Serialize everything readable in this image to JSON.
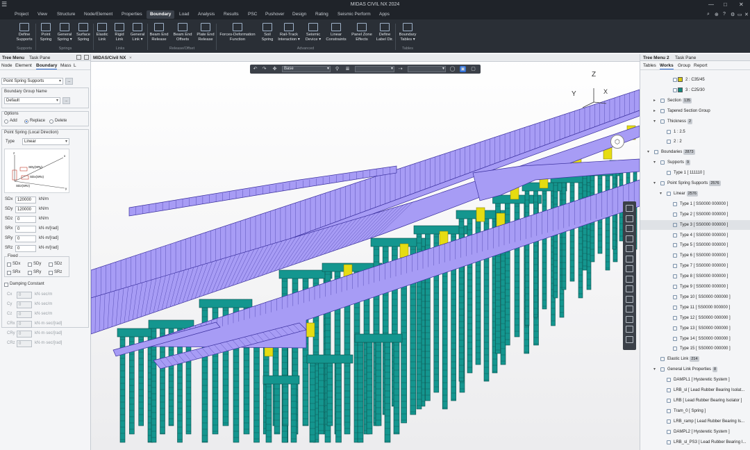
{
  "app": {
    "title": "MIDAS CIVIL NX 2024",
    "window_controls": [
      "—",
      "□",
      "✕"
    ]
  },
  "menu": {
    "items": [
      "Project",
      "View",
      "Structure",
      "Node/Element",
      "Properties",
      "Boundary",
      "Load",
      "Analysis",
      "Results",
      "PSC",
      "Pushover",
      "Design",
      "Rating",
      "Seismic Perform",
      "Apps"
    ],
    "active": "Boundary",
    "right_icons": [
      "search-icon",
      "zoom-icon",
      "help-icon",
      "settings-icon",
      "restore-icon",
      "close-icon"
    ],
    "right_glyphs": [
      "⌕",
      "⊕",
      "?",
      "⚙",
      "▭",
      "✕"
    ]
  },
  "ribbon": {
    "buttons": [
      {
        "label": "Define\nSupports",
        "icon": "support-icon"
      },
      {
        "label": "Point\nSpring",
        "icon": "point-spring-icon"
      },
      {
        "label": "General\nSpring ▾",
        "icon": "general-spring-icon"
      },
      {
        "label": "Surface\nSpring",
        "icon": "surface-spring-icon"
      },
      {
        "label": "Elastic\nLink",
        "icon": "elastic-link-icon"
      },
      {
        "label": "Rigid\nLink",
        "icon": "rigid-link-icon"
      },
      {
        "label": "General\nLink ▾",
        "icon": "general-link-icon"
      },
      {
        "label": "Beam End\nRelease",
        "icon": "beam-end-release-icon"
      },
      {
        "label": "Beam End\nOffsets",
        "icon": "beam-end-offsets-icon"
      },
      {
        "label": "Plate End\nRelease",
        "icon": "plate-end-release-icon"
      },
      {
        "label": "Forces-Deformation\nFunction",
        "icon": "force-function-icon"
      },
      {
        "label": "Soil\nSpring",
        "icon": "soil-spring-icon"
      },
      {
        "label": "Rail-Track\nInteraction ▾",
        "icon": "rail-track-icon"
      },
      {
        "label": "Seismic\nDevice ▾",
        "icon": "seismic-device-icon"
      },
      {
        "label": "Linear\nConstraints",
        "icon": "linear-constraints-icon"
      },
      {
        "label": "Panel Zone\nEffects",
        "icon": "panel-zone-icon"
      },
      {
        "label": "Define\nLabel Dir.",
        "icon": "label-dir-icon"
      },
      {
        "label": "Boundary\nTables ▾",
        "icon": "boundary-tables-icon"
      }
    ],
    "groups": [
      "Supports",
      "Springs",
      "Links",
      "Release/Offset",
      "Advanced",
      "Tables"
    ]
  },
  "left_panel": {
    "header_tabs": [
      "Tree Menu",
      "Task Pane"
    ],
    "tabs": [
      "Node",
      "Element",
      "Boundary",
      "Mass",
      "L"
    ],
    "active_tab": "Boundary",
    "function_select": "Point Spring Supports",
    "group_label": "Boundary Group Name",
    "group_value": "Default",
    "options_label": "Options",
    "options": [
      "Add",
      "Replace",
      "Delete"
    ],
    "option_selected": "Replace",
    "spring_label": "Point Spring (Local Direction)",
    "type_label": "Type",
    "type_value": "Linear",
    "diagram_labels": [
      "SDz(SRz)",
      "SDx(SRx)",
      "SDy(SRy)",
      "x",
      "y",
      "z"
    ],
    "stiffness": [
      {
        "label": "SDx",
        "value": "120000",
        "unit": "kN/m"
      },
      {
        "label": "SDy",
        "value": "120000",
        "unit": "kN/m"
      },
      {
        "label": "SDz",
        "value": "0",
        "unit": "kN/m"
      },
      {
        "label": "SRx",
        "value": "0",
        "unit": "kN·m/[rad]"
      },
      {
        "label": "SRy",
        "value": "0",
        "unit": "kN·m/[rad]"
      },
      {
        "label": "SRz",
        "value": "0",
        "unit": "kN·m/[rad]"
      }
    ],
    "fixed_label": "Fixed",
    "fixed_items": [
      "SDx",
      "SDy",
      "SDz",
      "SRx",
      "SRy",
      "SRz"
    ],
    "damping_label": "Damping Constant",
    "damping": [
      {
        "label": "Cx",
        "value": "0",
        "unit": "kN·sec/m"
      },
      {
        "label": "Cy",
        "value": "0",
        "unit": "kN·sec/m"
      },
      {
        "label": "Cz",
        "value": "0",
        "unit": "kN·sec/m"
      },
      {
        "label": "CRx",
        "value": "0",
        "unit": "kN·m·sec/[rad]"
      },
      {
        "label": "CRy",
        "value": "0",
        "unit": "kN·m·sec/[rad]"
      },
      {
        "label": "CRz",
        "value": "0",
        "unit": "kN·m·sec/[rad]"
      }
    ]
  },
  "viewport": {
    "tab": "MIDAS/Civil NX",
    "view_select": "Base",
    "axis_labels": [
      "Z",
      "Y",
      "X"
    ],
    "colors": {
      "deck": "#a79cf5",
      "deck_line": "#3a2f9e",
      "pier": "#14968f",
      "pier_line": "#0a4f4b",
      "bearing": "#e6dc12"
    }
  },
  "right_panel": {
    "header_tabs": [
      "Tree Menu 2",
      "Task Pane"
    ],
    "tabs": [
      "Tables",
      "Works",
      "Group",
      "Report"
    ],
    "active_tab": "Works",
    "tree": [
      {
        "text": "2 : C35/45",
        "indent": 3,
        "swatch": "#d6c814"
      },
      {
        "text": "3 : C25/30",
        "indent": 3,
        "swatch": "#138a80"
      },
      {
        "text": "Section",
        "badge": "135",
        "indent": 1,
        "arrow": "▸"
      },
      {
        "text": "Tapered Section Group",
        "indent": 1,
        "arrow": "▸"
      },
      {
        "text": "Thickness",
        "badge": "2",
        "indent": 1,
        "arrow": "▾"
      },
      {
        "text": "1 : 2.5",
        "indent": 2
      },
      {
        "text": "2 : 2",
        "indent": 2
      },
      {
        "text": "Boundaries",
        "badge": "2873",
        "indent": 0,
        "arrow": "▾"
      },
      {
        "text": "Supports",
        "badge": "9",
        "indent": 1,
        "arrow": "▾"
      },
      {
        "text": "Type 1 [ 111110 ]",
        "indent": 2
      },
      {
        "text": "Point Spring Supports",
        "badge": "2576",
        "indent": 1,
        "arrow": "▾"
      },
      {
        "text": "Linear",
        "badge": "2576",
        "indent": 2,
        "arrow": "▾"
      },
      {
        "text": "Type 1 [ SS0000 000000 ]",
        "indent": 3
      },
      {
        "text": "Type 2 [ SS0000 000000 ]",
        "indent": 3
      },
      {
        "text": "Type 3 [ SS0000 000000 ]",
        "indent": 3,
        "selected": true
      },
      {
        "text": "Type 4 [ SS0000 000000 ]",
        "indent": 3
      },
      {
        "text": "Type 5 [ SS0000 000000 ]",
        "indent": 3
      },
      {
        "text": "Type 6 [ SS0000 000000 ]",
        "indent": 3
      },
      {
        "text": "Type 7 [ SS0000 000000 ]",
        "indent": 3
      },
      {
        "text": "Type 8 [ SS0000 000000 ]",
        "indent": 3
      },
      {
        "text": "Type 9 [ SS0000 000000 ]",
        "indent": 3
      },
      {
        "text": "Type 10 [ SS0000 000000 ]",
        "indent": 3
      },
      {
        "text": "Type 11 [ SS0000 000000 ]",
        "indent": 3
      },
      {
        "text": "Type 12 [ SS0000 000000 ]",
        "indent": 3
      },
      {
        "text": "Type 13 [ SS0000 000000 ]",
        "indent": 3
      },
      {
        "text": "Type 14 [ SS0000 000000 ]",
        "indent": 3
      },
      {
        "text": "Type 15 [ SS0000 000000 ]",
        "indent": 3
      },
      {
        "text": "Elastic Link",
        "badge": "214",
        "indent": 1
      },
      {
        "text": "General Link Properties",
        "badge": "8",
        "indent": 1,
        "arrow": "▾"
      },
      {
        "text": "DAMPL1 [ Hysteretic System ]",
        "indent": 2
      },
      {
        "text": "LRB_sl [ Lead Rubber Bearing Isolat...",
        "indent": 2
      },
      {
        "text": "LRB [ Lead Rubber Bearing Isolator ]",
        "indent": 2
      },
      {
        "text": "Tram_0 [ Spring ]",
        "indent": 2
      },
      {
        "text": "LRB_ramp [ Lead Rubber Bearing Is...",
        "indent": 2
      },
      {
        "text": "DAMPL2 [ Hysteretic System ]",
        "indent": 2
      },
      {
        "text": "LRB_sl_PS3 [ Lead Rubber Bearing I...",
        "indent": 2
      }
    ]
  }
}
